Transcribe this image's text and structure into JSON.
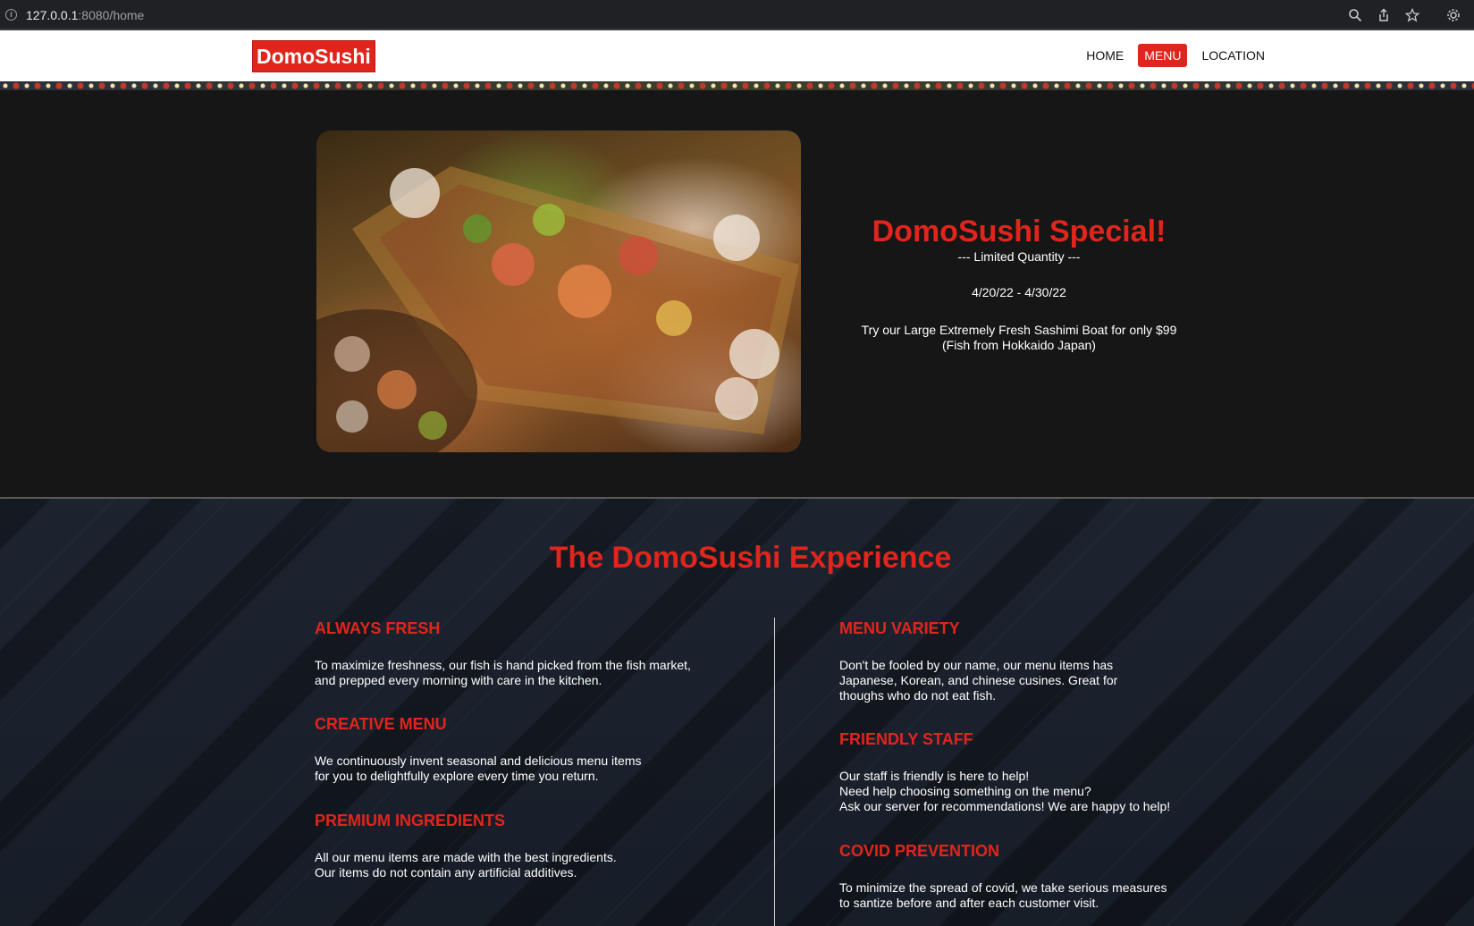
{
  "browser": {
    "url_host": "127.0.0.1",
    "url_path": ":8080/home",
    "icons": [
      "info-icon",
      "zoom-icon",
      "share-icon",
      "bookmark-star-icon",
      "extension-icon"
    ]
  },
  "nav": {
    "logo": "DomoSushi",
    "links": [
      "HOME",
      "MENU",
      "LOCATION"
    ],
    "active": "MENU",
    "accent_color": "#e0251c"
  },
  "special": {
    "image_alt": "Sashimi boat platter",
    "title": "DomoSushi Special!",
    "subtitle": "--- Limited Quantity ---",
    "dates": "4/20/22 - 4/30/22",
    "offer_line1": "Try our Large Extremely Fresh Sashimi Boat for only $99",
    "offer_line2": "(Fish from Hokkaido Japan)"
  },
  "experience": {
    "title": "The DomoSushi Experience",
    "left": [
      {
        "heading": "ALWAYS FRESH",
        "body": "To maximize freshness, our fish is hand picked from the fish market,\nand prepped every morning with care in the kitchen."
      },
      {
        "heading": "CREATIVE MENU",
        "body": "We continuously invent seasonal and delicious menu items\nfor you to delightfully explore every time you return."
      },
      {
        "heading": "PREMIUM INGREDIENTS",
        "body": "All our menu items are made with the best ingredients.\nOur items do not contain any artificial additives."
      }
    ],
    "right": [
      {
        "heading": "MENU VARIETY",
        "body": "Don't be fooled by our name, our menu items has\nJapanese, Korean, and chinese cusines. Great for\nthoughs who do not eat fish."
      },
      {
        "heading": "FRIENDLY STAFF",
        "body": "Our staff is friendly is here to help!\nNeed help choosing something on the menu?\nAsk our server for recommendations! We are happy to help!"
      },
      {
        "heading": "COVID PREVENTION",
        "body": "To minimize the spread of covid, we take serious measures\nto santize before and after each customer visit."
      }
    ]
  }
}
